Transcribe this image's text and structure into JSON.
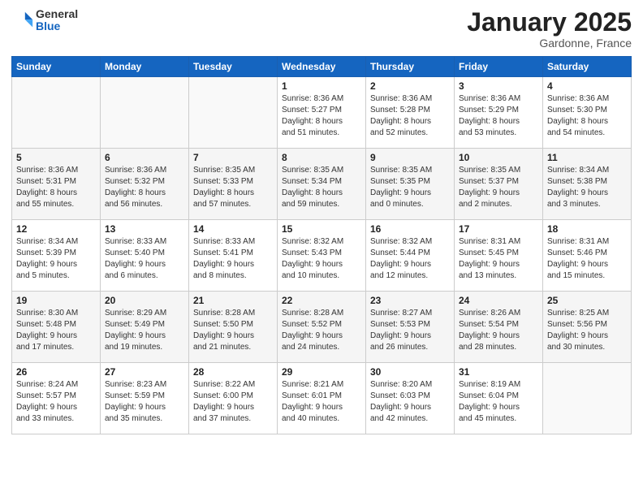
{
  "logo": {
    "general": "General",
    "blue": "Blue"
  },
  "header": {
    "month": "January 2025",
    "location": "Gardonne, France"
  },
  "days_of_week": [
    "Sunday",
    "Monday",
    "Tuesday",
    "Wednesday",
    "Thursday",
    "Friday",
    "Saturday"
  ],
  "weeks": [
    [
      {
        "day": "",
        "info": ""
      },
      {
        "day": "",
        "info": ""
      },
      {
        "day": "",
        "info": ""
      },
      {
        "day": "1",
        "info": "Sunrise: 8:36 AM\nSunset: 5:27 PM\nDaylight: 8 hours\nand 51 minutes."
      },
      {
        "day": "2",
        "info": "Sunrise: 8:36 AM\nSunset: 5:28 PM\nDaylight: 8 hours\nand 52 minutes."
      },
      {
        "day": "3",
        "info": "Sunrise: 8:36 AM\nSunset: 5:29 PM\nDaylight: 8 hours\nand 53 minutes."
      },
      {
        "day": "4",
        "info": "Sunrise: 8:36 AM\nSunset: 5:30 PM\nDaylight: 8 hours\nand 54 minutes."
      }
    ],
    [
      {
        "day": "5",
        "info": "Sunrise: 8:36 AM\nSunset: 5:31 PM\nDaylight: 8 hours\nand 55 minutes."
      },
      {
        "day": "6",
        "info": "Sunrise: 8:36 AM\nSunset: 5:32 PM\nDaylight: 8 hours\nand 56 minutes."
      },
      {
        "day": "7",
        "info": "Sunrise: 8:35 AM\nSunset: 5:33 PM\nDaylight: 8 hours\nand 57 minutes."
      },
      {
        "day": "8",
        "info": "Sunrise: 8:35 AM\nSunset: 5:34 PM\nDaylight: 8 hours\nand 59 minutes."
      },
      {
        "day": "9",
        "info": "Sunrise: 8:35 AM\nSunset: 5:35 PM\nDaylight: 9 hours\nand 0 minutes."
      },
      {
        "day": "10",
        "info": "Sunrise: 8:35 AM\nSunset: 5:37 PM\nDaylight: 9 hours\nand 2 minutes."
      },
      {
        "day": "11",
        "info": "Sunrise: 8:34 AM\nSunset: 5:38 PM\nDaylight: 9 hours\nand 3 minutes."
      }
    ],
    [
      {
        "day": "12",
        "info": "Sunrise: 8:34 AM\nSunset: 5:39 PM\nDaylight: 9 hours\nand 5 minutes."
      },
      {
        "day": "13",
        "info": "Sunrise: 8:33 AM\nSunset: 5:40 PM\nDaylight: 9 hours\nand 6 minutes."
      },
      {
        "day": "14",
        "info": "Sunrise: 8:33 AM\nSunset: 5:41 PM\nDaylight: 9 hours\nand 8 minutes."
      },
      {
        "day": "15",
        "info": "Sunrise: 8:32 AM\nSunset: 5:43 PM\nDaylight: 9 hours\nand 10 minutes."
      },
      {
        "day": "16",
        "info": "Sunrise: 8:32 AM\nSunset: 5:44 PM\nDaylight: 9 hours\nand 12 minutes."
      },
      {
        "day": "17",
        "info": "Sunrise: 8:31 AM\nSunset: 5:45 PM\nDaylight: 9 hours\nand 13 minutes."
      },
      {
        "day": "18",
        "info": "Sunrise: 8:31 AM\nSunset: 5:46 PM\nDaylight: 9 hours\nand 15 minutes."
      }
    ],
    [
      {
        "day": "19",
        "info": "Sunrise: 8:30 AM\nSunset: 5:48 PM\nDaylight: 9 hours\nand 17 minutes."
      },
      {
        "day": "20",
        "info": "Sunrise: 8:29 AM\nSunset: 5:49 PM\nDaylight: 9 hours\nand 19 minutes."
      },
      {
        "day": "21",
        "info": "Sunrise: 8:28 AM\nSunset: 5:50 PM\nDaylight: 9 hours\nand 21 minutes."
      },
      {
        "day": "22",
        "info": "Sunrise: 8:28 AM\nSunset: 5:52 PM\nDaylight: 9 hours\nand 24 minutes."
      },
      {
        "day": "23",
        "info": "Sunrise: 8:27 AM\nSunset: 5:53 PM\nDaylight: 9 hours\nand 26 minutes."
      },
      {
        "day": "24",
        "info": "Sunrise: 8:26 AM\nSunset: 5:54 PM\nDaylight: 9 hours\nand 28 minutes."
      },
      {
        "day": "25",
        "info": "Sunrise: 8:25 AM\nSunset: 5:56 PM\nDaylight: 9 hours\nand 30 minutes."
      }
    ],
    [
      {
        "day": "26",
        "info": "Sunrise: 8:24 AM\nSunset: 5:57 PM\nDaylight: 9 hours\nand 33 minutes."
      },
      {
        "day": "27",
        "info": "Sunrise: 8:23 AM\nSunset: 5:59 PM\nDaylight: 9 hours\nand 35 minutes."
      },
      {
        "day": "28",
        "info": "Sunrise: 8:22 AM\nSunset: 6:00 PM\nDaylight: 9 hours\nand 37 minutes."
      },
      {
        "day": "29",
        "info": "Sunrise: 8:21 AM\nSunset: 6:01 PM\nDaylight: 9 hours\nand 40 minutes."
      },
      {
        "day": "30",
        "info": "Sunrise: 8:20 AM\nSunset: 6:03 PM\nDaylight: 9 hours\nand 42 minutes."
      },
      {
        "day": "31",
        "info": "Sunrise: 8:19 AM\nSunset: 6:04 PM\nDaylight: 9 hours\nand 45 minutes."
      },
      {
        "day": "",
        "info": ""
      }
    ]
  ]
}
